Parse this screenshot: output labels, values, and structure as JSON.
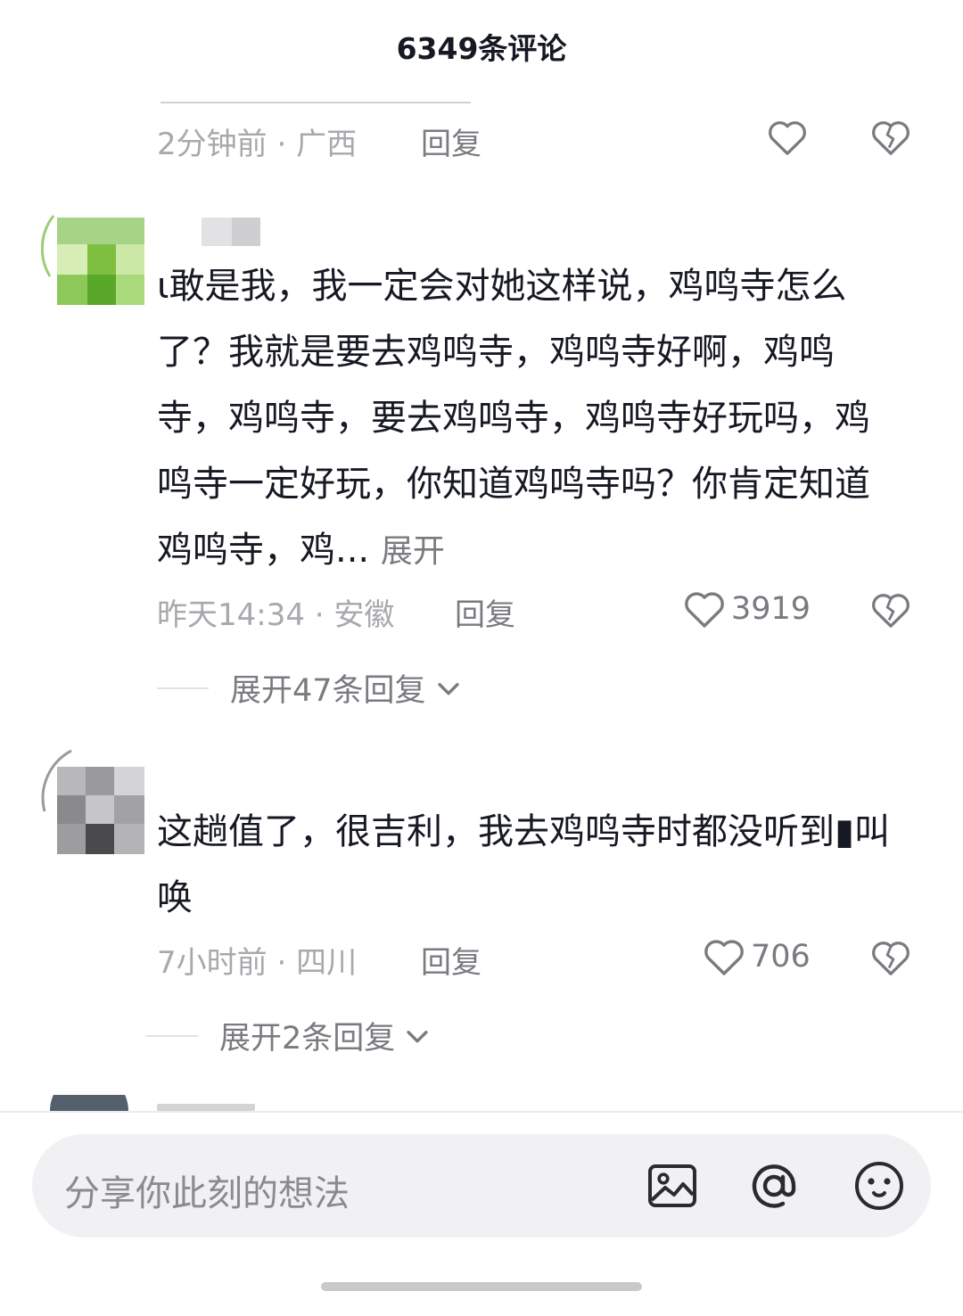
{
  "header": {
    "title": "6349条评论"
  },
  "comments": [
    {
      "time": "2分钟前",
      "location": "广西",
      "reply_label": "回复"
    },
    {
      "text": "ι敢是我，我一定会对她这样说，鸡鸣寺怎么了？我就是要去鸡鸣寺，鸡鸣寺好啊，鸡鸣寺，鸡鸣寺，要去鸡鸣寺，鸡鸣寺好玩吗，鸡鸣寺一定好玩，你知道鸡鸣寺吗？你肯定知道鸡鸣寺，鸡...",
      "expand_label": "展开",
      "time": "昨天14:34",
      "location": "安徽",
      "reply_label": "回复",
      "likes": "3919",
      "replies_toggle": "展开47条回复"
    },
    {
      "text": "这趟值了，很吉利，我去鸡鸣寺时都没听到▮叫唤",
      "time": "7小时前",
      "location": "四川",
      "reply_label": "回复",
      "likes": "706",
      "replies_toggle": "展开2条回复"
    }
  ],
  "input": {
    "placeholder": "分享你此刻的想法"
  },
  "icons": {
    "like": "heart-outline-icon",
    "dislike": "broken-heart-icon",
    "image": "image-icon",
    "mention": "at-icon",
    "emoji": "emoji-icon",
    "chevron": "chevron-down-icon"
  },
  "colors": {
    "text": "#161823",
    "muted": "#a8a8ad",
    "secondary": "#7a7a80"
  }
}
